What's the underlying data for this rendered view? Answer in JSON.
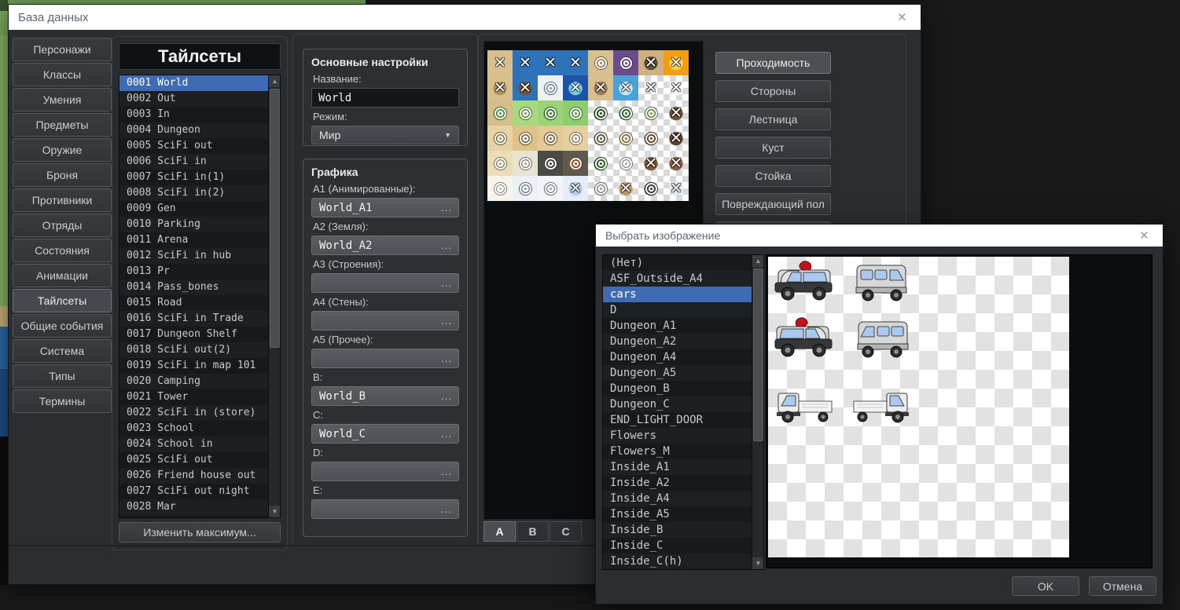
{
  "db_window": {
    "title": "База данных",
    "close_icon": "×",
    "sidebar": {
      "items": [
        "Персонажи",
        "Классы",
        "Умения",
        "Предметы",
        "Оружие",
        "Броня",
        "Противники",
        "Отряды",
        "Состояния",
        "Анимации",
        "Тайлсеты",
        "Общие события",
        "Система",
        "Типы",
        "Термины"
      ],
      "active_item": "Тайлсеты"
    },
    "tilesets_panel": {
      "header": "Тайлсеты",
      "items": [
        "0001 World",
        "0002 Out",
        "0003 In",
        "0004 Dungeon",
        "0005 SciFi out",
        "0006 SciFi in",
        "0007 SciFi in(1)",
        "0008 SciFi in(2)",
        "0009 Gen",
        "0010 Parking",
        "0011 Arena",
        "0012 SciFi in hub",
        "0013 Pr",
        "0014 Pass_bones",
        "0015 Road",
        "0016 SciFi in Trade",
        "0017 Dungeon Shelf",
        "0018 SciFi out(2)",
        "0019 SciFi in map 101",
        "0020 Camping",
        "0021 Tower",
        "0022 SciFi in (store)",
        "0023 School",
        "0024 School in",
        "0025 SciFi out",
        "0026 Friend house out",
        "0027 SciFi out night",
        "0028 Mar"
      ],
      "selected_item": "0001 World",
      "change_max_label": "Изменить максимум..."
    },
    "settings": {
      "basic_group_title": "Основные настройки",
      "name_label": "Название:",
      "name_value": "World",
      "mode_label": "Режим:",
      "mode_value": "Мир",
      "graphics_group_title": "Графика",
      "browse_icon": "...",
      "fields": [
        {
          "label": "A1 (Анимированные):",
          "value": "World_A1"
        },
        {
          "label": "A2 (Земля):",
          "value": "World_A2"
        },
        {
          "label": "A3 (Строения):",
          "value": ""
        },
        {
          "label": "A4 (Стены):",
          "value": ""
        },
        {
          "label": "A5 (Прочее):",
          "value": ""
        },
        {
          "label": "B:",
          "value": "World_B"
        },
        {
          "label": "C:",
          "value": "World_C"
        },
        {
          "label": "D:",
          "value": ""
        },
        {
          "label": "E:",
          "value": ""
        }
      ]
    },
    "tile_tabs": {
      "labels": [
        "A",
        "B",
        "C"
      ],
      "active": "A"
    },
    "mode_buttons": {
      "labels": [
        "Проходимость",
        "Стороны",
        "Лестница",
        "Куст",
        "Стойка",
        "Повреждающий пол"
      ],
      "active": "Проходимость"
    },
    "passability_grid": {
      "marker_legend": {
        "O": "passable",
        "X": "impassable"
      },
      "rows": [
        [
          {
            "b": "#d8bf8e",
            "m": "X"
          },
          {
            "b": "#2e72b8",
            "m": "X"
          },
          {
            "b": "#2e72b8",
            "m": "X"
          },
          {
            "b": "#2e72b8",
            "m": "X"
          },
          {
            "b": "#d8bf8e",
            "m": "O"
          },
          {
            "b": "#6b4b8e",
            "o": "#8a68b0",
            "m": "O"
          },
          {
            "b": "#cdb183",
            "o": "#5f5130",
            "m": "X"
          },
          {
            "b": "#f29d13",
            "o": "#ffd24a",
            "m": "X"
          }
        ],
        [
          {
            "b": "#d8bf8e",
            "o": "#b39158",
            "m": "X"
          },
          {
            "b": "#2e72b8",
            "o": "#6e5334",
            "m": "X"
          },
          {
            "b": "#eef2f5",
            "o": "#bcd8ea",
            "m": "O"
          },
          {
            "b": "#1d53a6",
            "o": "#74cdf0",
            "m": "X"
          },
          {
            "b": "#d8bf8e",
            "o": "#9d7d4e",
            "m": "X"
          },
          {
            "b": "#49a3d9",
            "o": "#c2ebf8",
            "m": "X"
          },
          {
            "b": "ck",
            "m": "X"
          },
          {
            "b": "ck",
            "o": "#f4f8fb",
            "m": "X"
          }
        ],
        [
          {
            "b": "#d5bd8c",
            "o": "#79c763",
            "m": "O"
          },
          {
            "b": "#a6d980",
            "m": "O"
          },
          {
            "b": "#9cd378",
            "o": "#4dad45",
            "m": "O"
          },
          {
            "b": "#8ccd6e",
            "m": "O"
          },
          {
            "b": "ck",
            "o": "#2e6b2a",
            "m": "O"
          },
          {
            "b": "ck",
            "o": "#3f8f38",
            "m": "O"
          },
          {
            "b": "ck",
            "o": "#a9d37f",
            "m": "O"
          },
          {
            "b": "ck",
            "o": "#6d5135",
            "m": "X"
          }
        ],
        [
          {
            "b": "#e7d2a6",
            "o": "#d6ba81",
            "m": "O"
          },
          {
            "b": "#dfc28a",
            "o": "#c7a365",
            "m": "O"
          },
          {
            "b": "#e2c996",
            "o": "#bd9e67",
            "m": "O"
          },
          {
            "b": "#e5cf9f",
            "m": "O"
          },
          {
            "b": "ck",
            "o": "#8d7c59",
            "m": "O"
          },
          {
            "b": "ck",
            "o": "#c7a56a",
            "m": "O"
          },
          {
            "b": "ck",
            "o": "#8a6a41",
            "m": "O"
          },
          {
            "b": "ck",
            "o": "#59442d",
            "m": "X"
          }
        ],
        [
          {
            "b": "#ecdcb8",
            "m": "O"
          },
          {
            "b": "#e9e3d4",
            "m": "O"
          },
          {
            "b": "#4b4b45",
            "o": "#5d5d55",
            "m": "O"
          },
          {
            "b": "#5d594c",
            "o": "#c96f2a",
            "m": "O"
          },
          {
            "b": "ck",
            "o": "#3e7a33",
            "m": "O"
          },
          {
            "b": "ck",
            "o": "#eceff1",
            "m": "O"
          },
          {
            "b": "ck",
            "o": "#7a5a36",
            "m": "X"
          },
          {
            "b": "ck",
            "o": "#8c5c41",
            "m": "X"
          }
        ],
        [
          {
            "b": "#f8f4ec",
            "o": "#ffffff",
            "m": "O"
          },
          {
            "b": "#ecf1f6",
            "o": "#c3d7e9",
            "m": "O"
          },
          {
            "b": "#f1f4f8",
            "o": "#dbe7f1",
            "m": "O"
          },
          {
            "b": "#e6edf6",
            "o": "#b7cee8",
            "m": "X"
          },
          {
            "b": "ck",
            "o": "#d7d7d7",
            "m": "O"
          },
          {
            "b": "ck",
            "o": "#bb9c63",
            "m": "X"
          },
          {
            "b": "ck",
            "o": "#50504b",
            "m": "O"
          },
          {
            "b": "ck",
            "o": "#dfe9f2",
            "m": "X"
          }
        ]
      ]
    }
  },
  "image_dialog": {
    "title": "Выбрать изображение",
    "close_icon": "×",
    "files": [
      "(Нет)",
      "ASF_Outside_A4",
      "cars",
      "D",
      "Dungeon_A1",
      "Dungeon_A2",
      "Dungeon_A4",
      "Dungeon_A5",
      "Dungeon_B",
      "Dungeon_C",
      "END_LIGHT_DOOR",
      "Flowers",
      "Flowers_M",
      "Inside_A1",
      "Inside_A2",
      "Inside_A4",
      "Inside_A5",
      "Inside_B",
      "Inside_C",
      "Inside_C(h)"
    ],
    "selected_file": "cars",
    "vehicles": [
      {
        "kind": "suv",
        "facing": "left",
        "red_light": true
      },
      {
        "kind": "van",
        "facing": "right",
        "red_light": false
      },
      {
        "kind": "suv",
        "facing": "right",
        "red_light": true
      },
      {
        "kind": "van",
        "facing": "left",
        "red_light": false
      },
      {
        "kind": "truck",
        "facing": "left",
        "red_light": false
      },
      {
        "kind": "truck",
        "facing": "right",
        "red_light": false
      }
    ],
    "ok_label": "OK",
    "cancel_label": "Отмена"
  },
  "colors": {
    "window_bg": "#2b2e31",
    "titlebar_bg": "#ffffff",
    "selection_blue": "#3e6bb4",
    "list_bg": "#17191b",
    "accent_button": "#4c5054"
  }
}
